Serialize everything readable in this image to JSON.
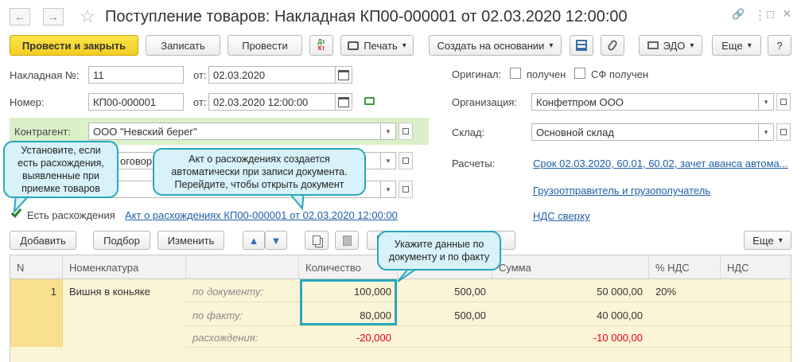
{
  "window": {
    "title": "Поступление товаров: Накладная КП00-000001 от 02.03.2020 12:00:00",
    "back_glyph": "←",
    "forward_glyph": "→",
    "star_glyph": "☆",
    "link_glyph": "🔗",
    "more_glyph": "⋮",
    "max_glyph": "□",
    "close_glyph": "×"
  },
  "toolbar": {
    "post_close": "Провести и закрыть",
    "save": "Записать",
    "post": "Провести",
    "dtkt_top": "Дт",
    "dtkt_bottom": "Кт",
    "print": "Печать",
    "create_based": "Создать на основании",
    "edo": "ЭДО",
    "more": "Еще",
    "help": "?",
    "dropdown_glyph": "▾"
  },
  "header": {
    "invoice_no_label": "Накладная №:",
    "invoice_no": "11",
    "from_label": "от:",
    "invoice_date": "02.03.2020",
    "number_label": "Номер:",
    "number": "КП00-000001",
    "from_label2": "от:",
    "doc_datetime": "02.03.2020 12:00:00",
    "counterparty_label": "Контрагент:",
    "counterparty": "ООО \"Невский берег\"",
    "contract_partial": "оговор",
    "original_label": "Оригинал:",
    "received_label": "получен",
    "sf_received_label": "СФ получен",
    "org_label": "Организация:",
    "org": "Конфетпром ООО",
    "warehouse_label": "Склад:",
    "warehouse": "Основной склад",
    "settlements_label": "Расчеты:",
    "settlements_link": "Срок 02.03.2020, 60.01, 60.02, зачет аванса автома...",
    "shipper_link": "Грузоотправитель и грузополучатель",
    "vat_link": "НДС сверху",
    "discrepancy_label": "Есть расхождения",
    "discrepancy_act_link": "Акт о расхождениях КП00-000001 от 02.03.2020 12:00:00"
  },
  "table_toolbar": {
    "add": "Добавить",
    "pick": "Подбор",
    "edit": "Изменить",
    "more": "Еще"
  },
  "table": {
    "columns": [
      "N",
      "Номенклатура",
      "",
      "Количество",
      "",
      "Сумма",
      "% НДС",
      "НДС"
    ],
    "row": {
      "n": "1",
      "item": "Вишня в коньяке",
      "by_doc_label": "по документу:",
      "by_fact_label": "по факту:",
      "diff_label": "расхождения:",
      "qty_doc": "100,000",
      "qty_fact": "80,000",
      "qty_diff": "-20,000",
      "price_doc": "500,00",
      "price_fact": "500,00",
      "sum_doc": "50 000,00",
      "sum_fact": "40 000,00",
      "sum_diff": "-10 000,00",
      "vat_rate": "20%"
    }
  },
  "callouts": {
    "c1": "Установите, если есть расхождения, выявленные при приемке товаров",
    "c2": "Акт о расхождениях создается автоматически при записи документа. Перейдите, чтобы открыть документ",
    "c3": "Укажите данные по документу и по факту"
  },
  "colors": {
    "accent_yellow": "#f4cd23",
    "callout_border": "#2aa7bd",
    "callout_fill": "#d7f2f8",
    "link": "#1f5fa8",
    "negative": "#e0001b",
    "row_highlight": "#fcf4d6",
    "counterparty_band": "#d9f0c8"
  }
}
